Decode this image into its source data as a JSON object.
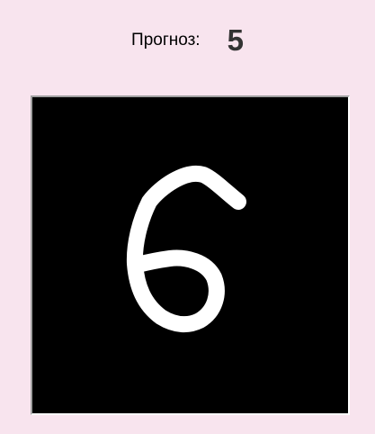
{
  "prediction": {
    "label": "Прогноз:",
    "value": "5"
  },
  "canvas": {
    "background_color": "#000000",
    "stroke_color": "#ffffff",
    "drawn_digit": "6"
  },
  "colors": {
    "window_background": "#f8e4ee",
    "value_text": "#333333"
  }
}
